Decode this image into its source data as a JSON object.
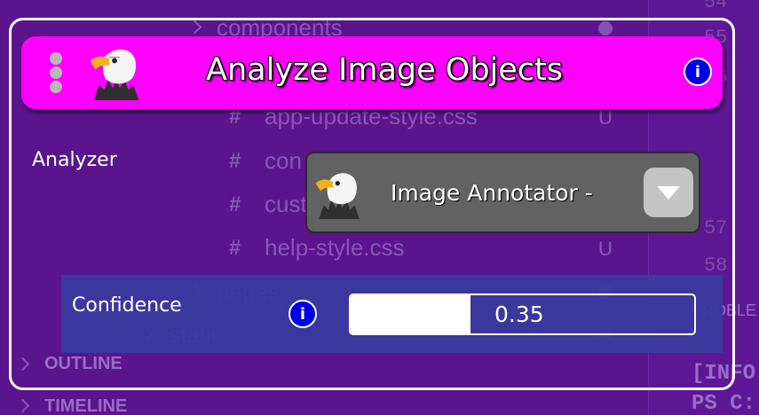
{
  "background": {
    "explorer_items": [
      "components",
      "app-update-style.css",
      "con",
      "cust",
      "help-style.css",
      "pages",
      "static"
    ],
    "status_letters": [
      "U",
      "U"
    ],
    "line_numbers": [
      "54",
      "55",
      "56",
      "57",
      "58"
    ],
    "sections": [
      "OUTLINE",
      "TIMELINE"
    ],
    "panel_tab": "PROBLE",
    "terminal_lines": [
      "[INFO",
      "PS C:"
    ]
  },
  "header": {
    "title": "Analyze Image Objects",
    "menu_icon": "kebab-menu-icon",
    "logo_icon": "eagle-icon",
    "info_icon": "i",
    "color": "#ff00ff"
  },
  "analyzer": {
    "label": "Analyzer",
    "selected": "Image Annotator -",
    "logo_icon": "eagle-icon",
    "dropdown_icon": "chevron-down-icon"
  },
  "confidence": {
    "label": "Confidence",
    "info_icon": "i",
    "value": "0.35",
    "fraction": 0.35
  }
}
